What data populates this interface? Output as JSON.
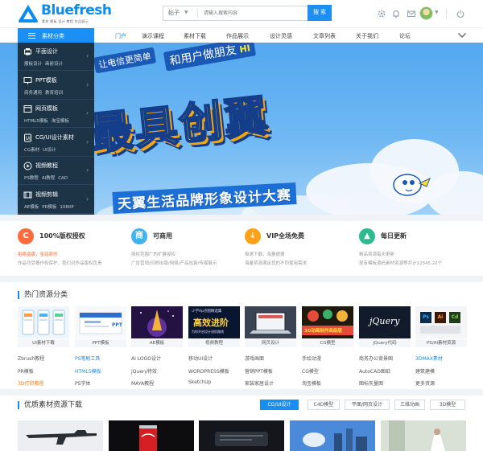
{
  "brand": {
    "name": "Bluefresh",
    "tagline": "素材 模板 设计 教程 作品展示"
  },
  "search": {
    "category": "帖子",
    "placeholder": "请输入搜索内容",
    "button": "搜 索"
  },
  "nav": {
    "category_button": "素材分类",
    "links": [
      {
        "label": "门户",
        "active": true
      },
      {
        "label": "演示课程"
      },
      {
        "label": "素材下载"
      },
      {
        "label": "作品展示"
      },
      {
        "label": "设计灵感"
      },
      {
        "label": "文章列表"
      },
      {
        "label": "关于我们"
      },
      {
        "label": "论坛"
      }
    ]
  },
  "sidebar": [
    {
      "title": "平面设计",
      "subs": [
        "展板设计",
        "画册设计"
      ],
      "icon": "print-icon"
    },
    {
      "title": "PPT模板",
      "subs": [
        "商务通用",
        "教育培训"
      ],
      "icon": "presentation-icon"
    },
    {
      "title": "网页模板",
      "subs": [
        "HTML5模板",
        "淘宝模板"
      ],
      "icon": "web-icon"
    },
    {
      "title": "CG/UI设计素材",
      "subs": [
        "CG素材",
        "UI设计"
      ],
      "icon": "ui-icon"
    },
    {
      "title": "视频教程",
      "subs": [
        "PS教程",
        "AI教程",
        "CAD"
      ],
      "icon": "video-icon"
    },
    {
      "title": "视频剪辑",
      "subs": [
        "AE模板",
        "PR模板",
        "1080P"
      ],
      "icon": "film-icon"
    }
  ],
  "banner": {
    "slogan_1": "让电信更简单",
    "slogan_2": "和用户做朋友",
    "slogan_2_hi": "HI",
    "title": "最具创翼",
    "subtitle": "天翼生活品牌形象设计大赛"
  },
  "features": [
    {
      "icon_text": "C",
      "title": "100%版权授权",
      "line1_hl": "拒绝盗版，全站原创",
      "line2": "作品均受著作权保护，我们对作品版权负责",
      "color": "#ff6b3d"
    },
    {
      "icon_text": "商",
      "title": "可商用",
      "line1": "授权范围广的扩展授权",
      "line2": "广告营销/印刷出版/网络/产品包装/传媒展示",
      "color": "#3fb4ef"
    },
    {
      "icon_text": "↓",
      "title": "VIP全场免费",
      "line1": "极速下载，海量便捷",
      "line2": "海量资源满足您的不同使用需求",
      "color": "#ffa21a"
    },
    {
      "icon_text": "▲",
      "title": "每日更新",
      "line1": "精品资源每天更新",
      "line2": "现有模板源码素材资源等共计12345,22个",
      "color": "#2dbb8f"
    }
  ],
  "hot": {
    "heading": "热门资源分类",
    "thumbs": [
      {
        "caption": "UI素材下载"
      },
      {
        "caption": "PPT模板"
      },
      {
        "caption": "AE模板"
      },
      {
        "caption": "视频教程"
      },
      {
        "caption": "网页设计"
      },
      {
        "caption": "CG模型"
      },
      {
        "caption": "jQuery代码"
      },
      {
        "caption": "PS/AI素材资源"
      }
    ],
    "thumb_texts": {
      "ppt": "PPT",
      "video_line1": "少学Ap点图精选集",
      "video_line2": "高效进阶",
      "video_line3": "为你开启设计进阶路线",
      "cg": "3D动画制作高级版",
      "jquery": "jQuery",
      "ps": "Ps",
      "ai": "Ai",
      "cd": "Cd"
    },
    "tags": [
      [
        {
          "t": "Zbrush教程"
        },
        {
          "t": "PS笔刷工具",
          "c": "blue"
        },
        {
          "t": "AI LOGO设计"
        },
        {
          "t": "移动UI设计"
        },
        {
          "t": "游戏画面"
        },
        {
          "t": "手绘动漫"
        },
        {
          "t": "商务办公背景图"
        },
        {
          "t": "3DMAX素材",
          "c": "blue"
        }
      ],
      [
        {
          "t": "PR模板"
        },
        {
          "t": "HTML5模板",
          "c": "blue"
        },
        {
          "t": "jQuery特效"
        },
        {
          "t": "WORDPRESS模板"
        },
        {
          "t": "营销PPT模板"
        },
        {
          "t": "CG模型"
        },
        {
          "t": "AutoCAD图纸"
        },
        {
          "t": "建筑建模"
        }
      ],
      [
        {
          "t": "3D打印教程",
          "c": "orange"
        },
        {
          "t": "PS字体"
        },
        {
          "t": "MAYA教程"
        },
        {
          "t": "SketchUp"
        },
        {
          "t": "家装家居设计"
        },
        {
          "t": "淘宝模板"
        },
        {
          "t": "图标矢量图"
        },
        {
          "t": "更多资源"
        }
      ]
    ]
  },
  "quality": {
    "heading": "优质素材资源下载",
    "tabs": [
      {
        "label": "CG/UI设计",
        "on": true
      },
      {
        "label": "C4D模型"
      },
      {
        "label": "平面/网页设计"
      },
      {
        "label": "三维动画"
      },
      {
        "label": "3D模型"
      }
    ]
  }
}
